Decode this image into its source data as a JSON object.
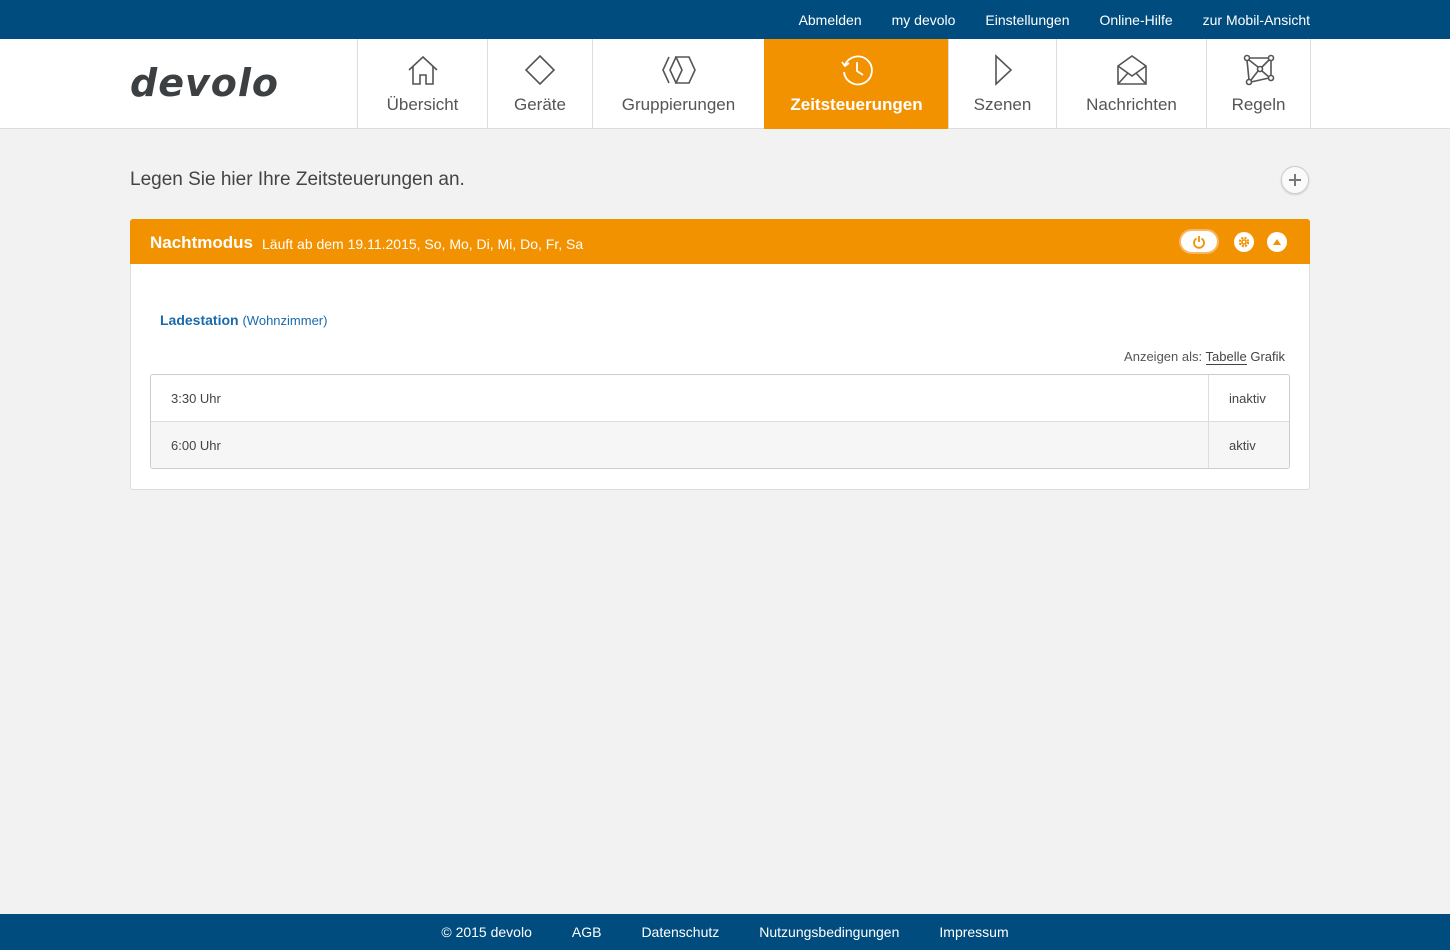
{
  "topbar": {
    "links": [
      "Abmelden",
      "my devolo",
      "Einstellungen",
      "Online-Hilfe",
      "zur Mobil-Ansicht"
    ]
  },
  "logo": {
    "text": "devolo",
    "color": "#3c4043"
  },
  "nav": {
    "items": [
      {
        "label": "Übersicht",
        "icon": "home-icon"
      },
      {
        "label": "Geräte",
        "icon": "diamond-icon"
      },
      {
        "label": "Gruppierungen",
        "icon": "group-icon"
      },
      {
        "label": "Zeitsteuerungen",
        "icon": "clock-icon",
        "active": true
      },
      {
        "label": "Szenen",
        "icon": "play-icon"
      },
      {
        "label": "Nachrichten",
        "icon": "envelope-icon"
      },
      {
        "label": "Regeln",
        "icon": "network-icon"
      }
    ]
  },
  "main": {
    "intro": "Legen Sie hier Ihre Zeitsteuerungen an.",
    "schedule": {
      "title": "Nachtmodus",
      "subtitle": "Läuft ab dem 19.11.2015, So, Mo, Di, Mi, Do, Fr, Sa",
      "device_name": "Ladestation",
      "device_room": "(Wohnzimmer)",
      "view_label": "Anzeigen als:",
      "view_options": [
        "Tabelle",
        "Grafik"
      ],
      "rows": [
        {
          "time": "3:30 Uhr",
          "state": "inaktiv"
        },
        {
          "time": "6:00 Uhr",
          "state": "aktiv"
        }
      ]
    }
  },
  "footer": {
    "copyright": "© 2015 devolo",
    "links": [
      "AGB",
      "Datenschutz",
      "Nutzungsbedingungen",
      "Impressum"
    ]
  },
  "colors": {
    "brand_blue": "#004c7e",
    "accent_orange": "#f39200",
    "link_blue": "#1a6aab"
  }
}
